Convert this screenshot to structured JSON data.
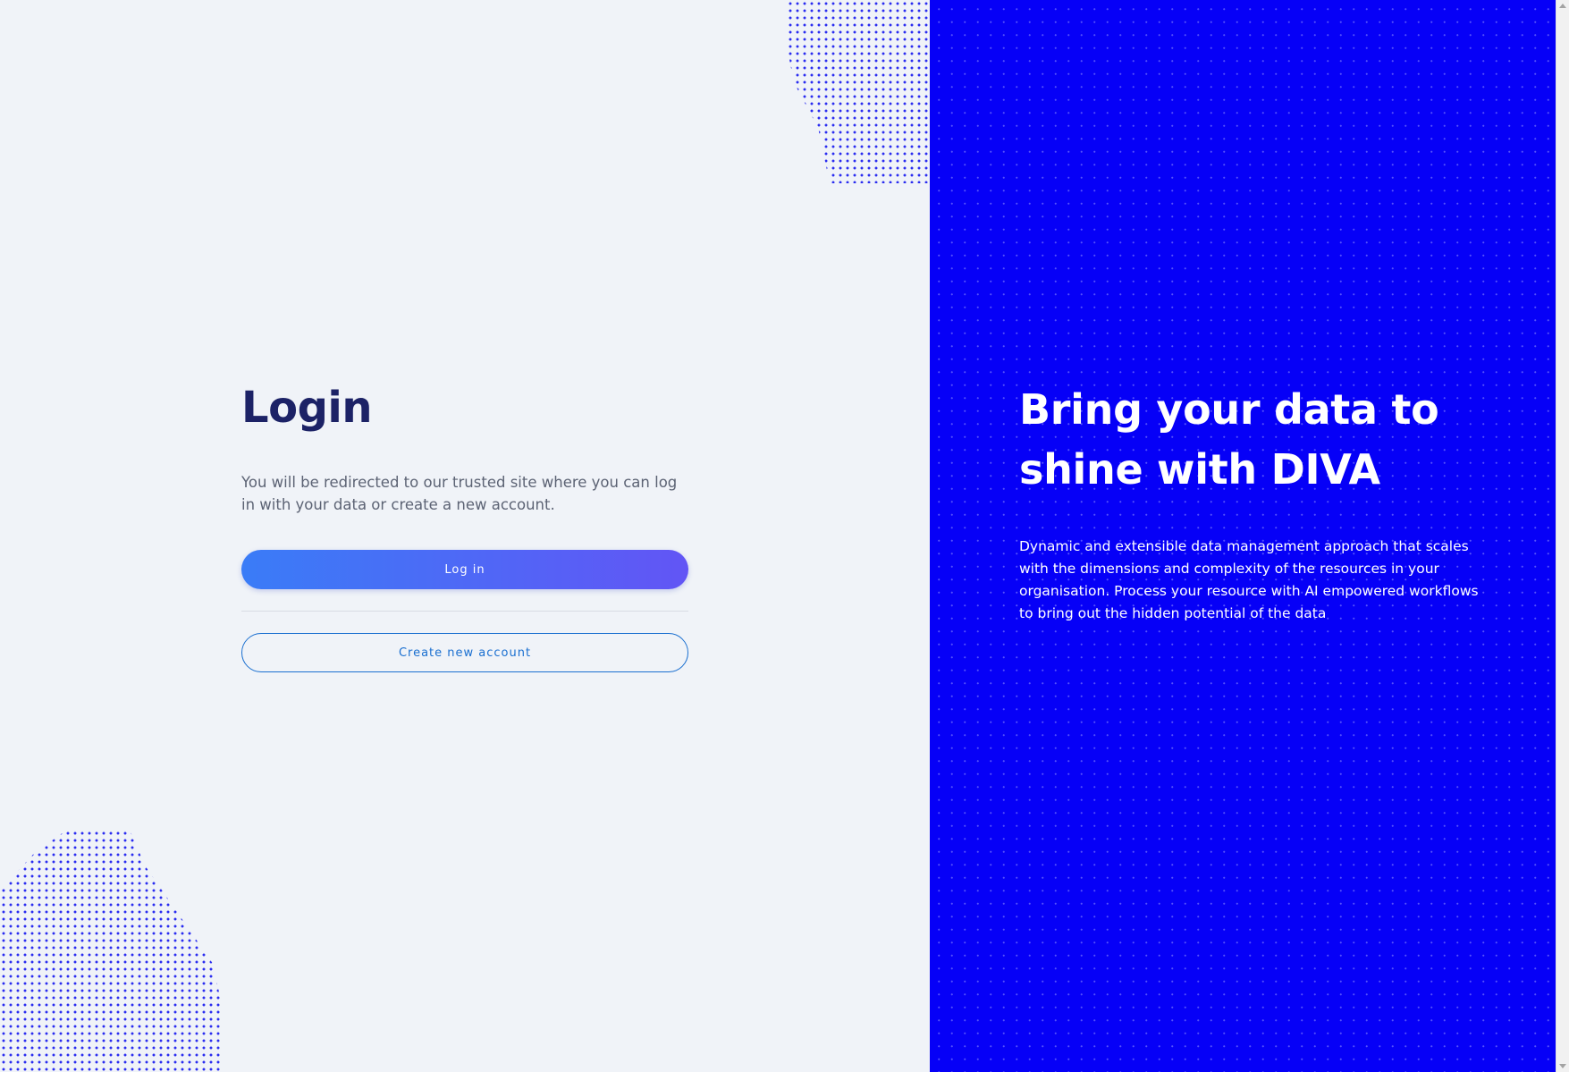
{
  "login": {
    "title": "Login",
    "description": "You will be redirected to our trusted site where you can log in with your data or create a new account.",
    "login_button": "Log in",
    "create_button": "Create new account"
  },
  "hero": {
    "title": "Bring your data to shine with DIVA",
    "description": "Dynamic and extensible data management approach that scales with the dimensions and complexity of the resources in your organisation. Process your resource with AI empowered workflows to bring out the hidden potential of the data"
  },
  "colors": {
    "right_pane_bg": "#0600f7",
    "left_pane_bg": "#f0f3f8",
    "title_color": "#1c2266",
    "login_gradient_start": "#3a7cf7",
    "login_gradient_end": "#6255f5",
    "create_border": "#1a6fd0"
  },
  "icons": {
    "scroll_up": "scroll-up-arrow-icon",
    "scroll_down": "scroll-down-arrow-icon"
  }
}
